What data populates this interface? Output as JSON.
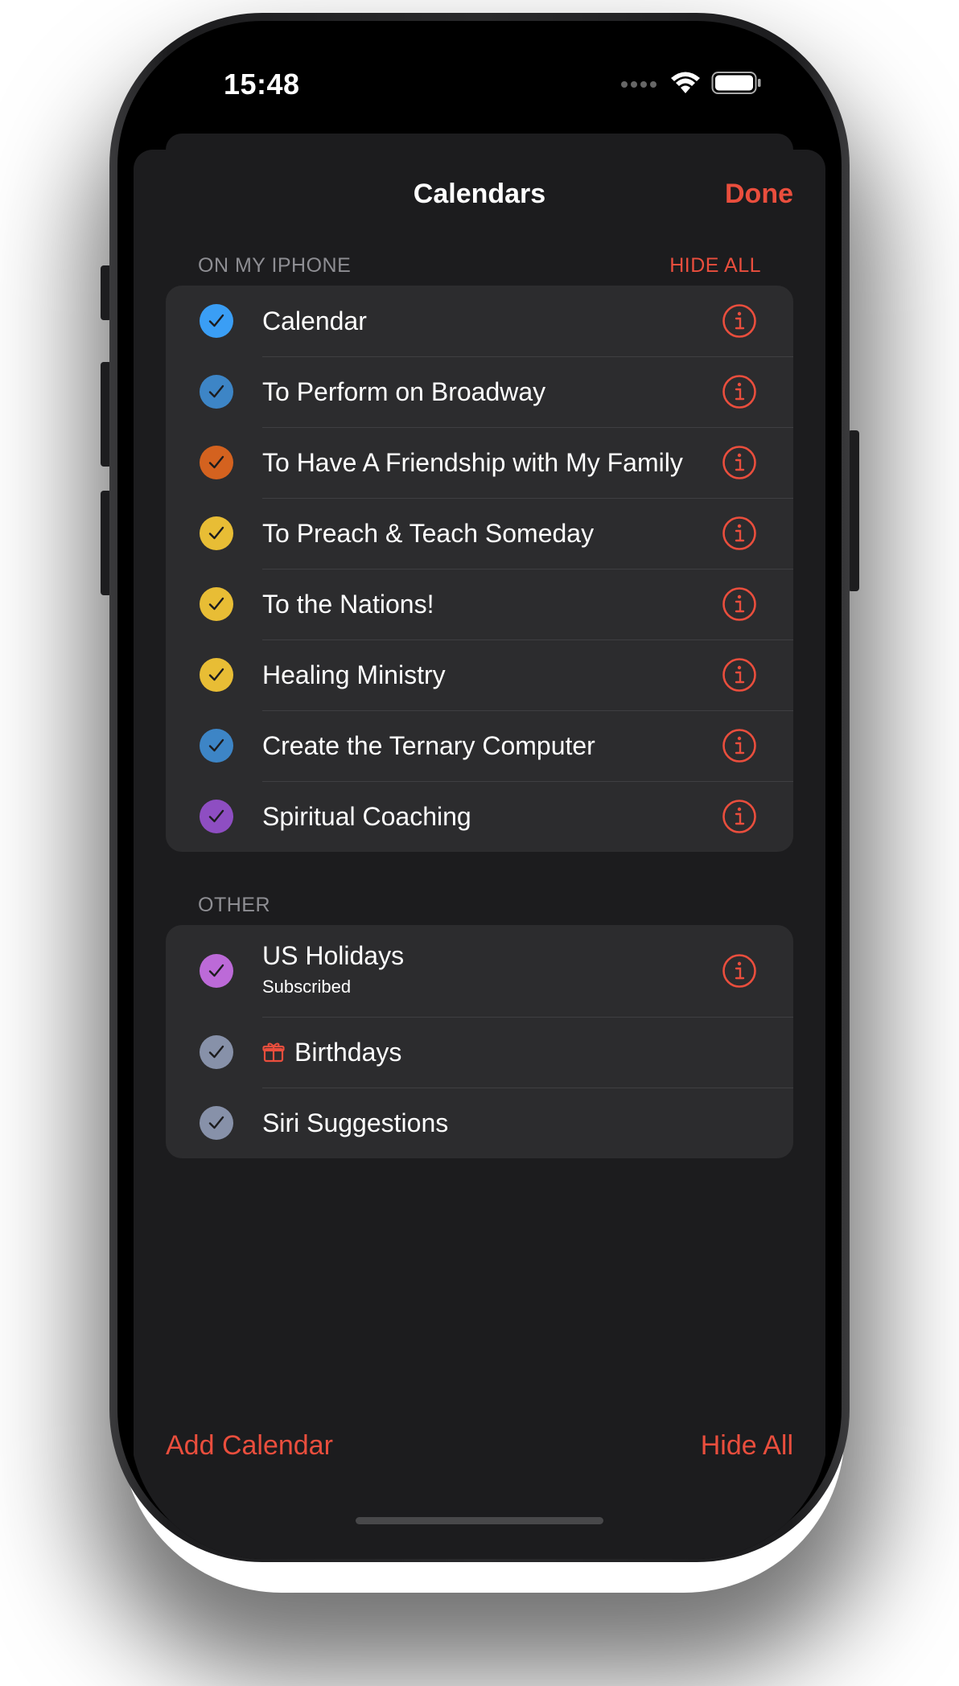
{
  "status": {
    "time": "15:48"
  },
  "nav": {
    "title": "Calendars",
    "done_label": "Done"
  },
  "section_iphone": {
    "header": "ON MY IPHONE",
    "hide_all_label": "HIDE ALL"
  },
  "iphone_calendars": [
    {
      "name": "Calendar",
      "color": "#3a9ef5"
    },
    {
      "name": "To Perform on Broadway",
      "color": "#3d85c6"
    },
    {
      "name": "To Have A Friendship with My Family",
      "color": "#d4621f"
    },
    {
      "name": "To Preach & Teach Someday",
      "color": "#e8bd35"
    },
    {
      "name": "To the Nations!",
      "color": "#e8bd35"
    },
    {
      "name": "Healing Ministry",
      "color": "#e8bd35"
    },
    {
      "name": "Create the Ternary Computer",
      "color": "#3d85c6"
    },
    {
      "name": "Spiritual Coaching",
      "color": "#8e4ec2"
    }
  ],
  "section_other": {
    "header": "OTHER"
  },
  "other_calendars": [
    {
      "name": "US Holidays",
      "subtitle": "Subscribed",
      "color": "#bc6ad8"
    },
    {
      "name": "Birthdays",
      "color": "#8791a9",
      "icon": "gift-icon"
    },
    {
      "name": "Siri Suggestions",
      "color": "#8791a9"
    }
  ],
  "footer": {
    "add_calendar_label": "Add Calendar",
    "hide_all_label": "Hide All"
  },
  "colors": {
    "accent": "#ea4e3d",
    "sheet_bg": "#1c1c1e",
    "cell_bg": "#2c2c2e"
  }
}
